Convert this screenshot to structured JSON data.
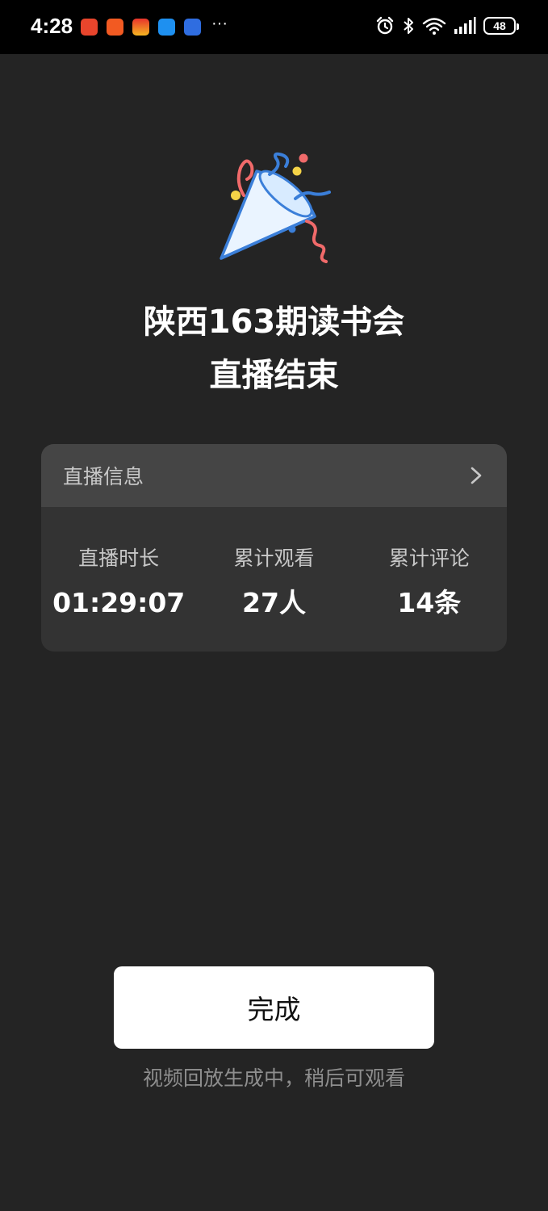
{
  "status_bar": {
    "time": "4:28",
    "more": "···",
    "battery": "48",
    "app_icons": [
      "app-icon-red",
      "app-icon-orange",
      "app-icon-gift",
      "app-icon-message",
      "app-icon-blue"
    ],
    "system_icons": [
      "alarm-icon",
      "bluetooth-icon",
      "wifi-icon",
      "signal-icon",
      "battery-icon"
    ]
  },
  "illustration": {
    "icon": "party-popper-icon",
    "colors": {
      "cone_outline": "#3b7fd9",
      "cone_fill": "#eaf4ff",
      "streamer_red": "#f06a6a",
      "confetti_yellow": "#f5d347",
      "streamer_blue": "#3b7fd9"
    }
  },
  "title": {
    "line1": "陕西163期读书会",
    "line2": "直播结束"
  },
  "info_card": {
    "header_label": "直播信息",
    "stats": [
      {
        "label": "直播时长",
        "value": "01:29:07"
      },
      {
        "label": "累计观看",
        "value": "27人"
      },
      {
        "label": "累计评论",
        "value": "14条"
      }
    ]
  },
  "actions": {
    "done_label": "完成",
    "replay_hint": "视频回放生成中，稍后可观看"
  },
  "colors": {
    "background": "#242424",
    "card": "#333333",
    "card_header": "#454545",
    "button": "#ffffff"
  }
}
